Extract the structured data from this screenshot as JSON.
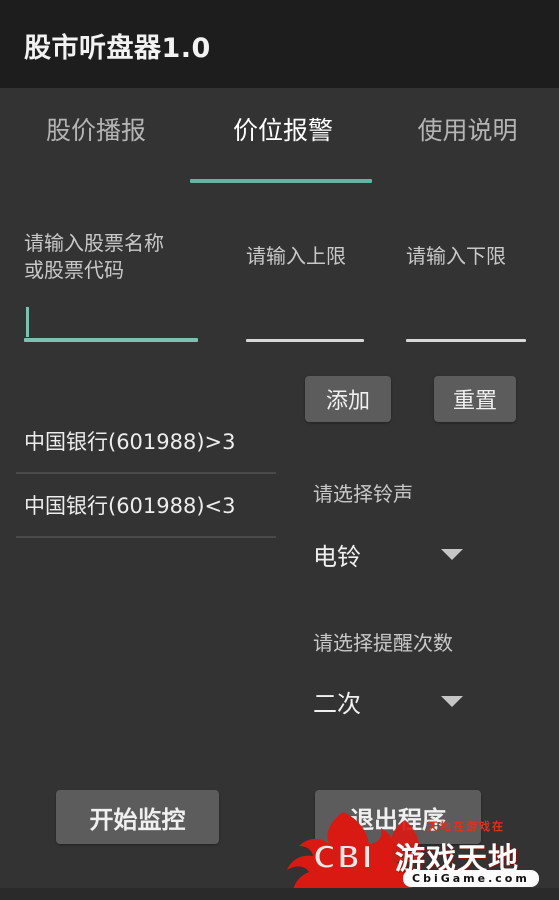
{
  "app": {
    "title": "股市听盘器1.0"
  },
  "tabs": [
    {
      "label": "股价播报",
      "active": false
    },
    {
      "label": "价位报警",
      "active": true
    },
    {
      "label": "使用说明",
      "active": false
    }
  ],
  "form": {
    "label_stock": "请输入股票名称\n或股票代码",
    "label_upper": "请输入上限",
    "label_lower": "请输入下限",
    "stock_value": "",
    "upper_value": "",
    "lower_value": "",
    "add_label": "添加",
    "reset_label": "重置"
  },
  "alerts": [
    {
      "text": "中国银行(601988)>3"
    },
    {
      "text": "中国银行(601988)<3"
    }
  ],
  "ringtone": {
    "label": "请选择铃声",
    "selected": "电铃"
  },
  "repeat": {
    "label": "请选择提醒次数",
    "selected": "二次"
  },
  "actions": {
    "start_label": "开始监控",
    "exit_label": "退出程序"
  },
  "watermark": {
    "tagline": "天地在游戏在",
    "brand_latin": "CBI",
    "brand_cn": "游戏天地",
    "url": "CbiGame.com"
  },
  "colors": {
    "accent_teal": "#63b5a3",
    "appbar_bg": "#1d1d1d",
    "page_bg": "#333333",
    "button_bg": "#5c5c5c",
    "watermark_red": "#d81a12"
  }
}
